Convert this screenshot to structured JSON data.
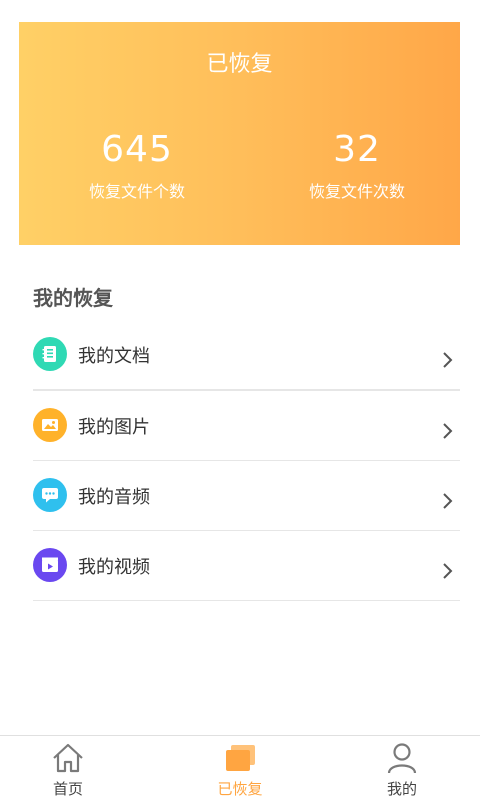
{
  "header": {
    "title": "已恢复",
    "stats": [
      {
        "value": "645",
        "label": "恢复文件个数"
      },
      {
        "value": "32",
        "label": "恢复文件次数"
      }
    ]
  },
  "section": {
    "title": "我的恢复"
  },
  "list": {
    "items": [
      {
        "label": "我的文档",
        "icon": "document-icon",
        "color": "#2fd9b4"
      },
      {
        "label": "我的图片",
        "icon": "image-icon",
        "color": "#ffb22a"
      },
      {
        "label": "我的音频",
        "icon": "chat-icon",
        "color": "#2fc0ee"
      },
      {
        "label": "我的视频",
        "icon": "video-icon",
        "color": "#6a48f0"
      }
    ]
  },
  "tabbar": {
    "tabs": [
      {
        "label": "首页",
        "icon": "home-icon",
        "active": false
      },
      {
        "label": "已恢复",
        "icon": "cards-icon",
        "active": true
      },
      {
        "label": "我的",
        "icon": "user-icon",
        "active": false
      }
    ]
  },
  "colors": {
    "accent": "#ffa541",
    "gradient_start": "#ffd066",
    "gradient_end": "#ffa748"
  }
}
